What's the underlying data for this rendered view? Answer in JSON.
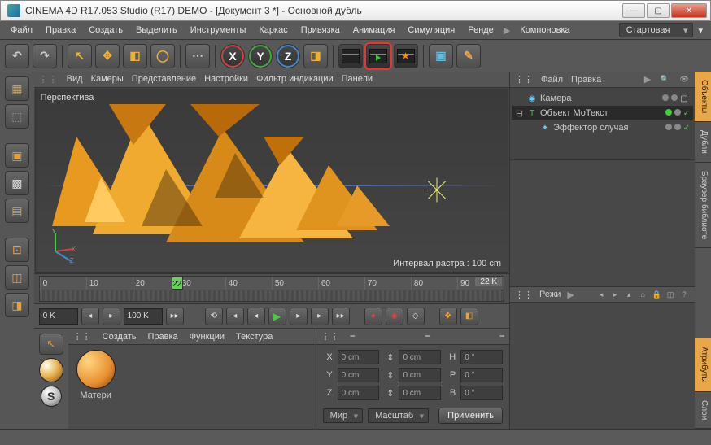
{
  "titlebar": {
    "text": "CINEMA 4D R17.053 Studio (R17) DEMO - [Документ 3 *] - Основной дубль"
  },
  "menubar": {
    "items": [
      "Файл",
      "Правка",
      "Создать",
      "Выделить",
      "Инструменты",
      "Каркас",
      "Привязка",
      "Анимация",
      "Симуляция",
      "Ренде"
    ],
    "items2": [
      "Компоновка"
    ],
    "layout": "Стартовая"
  },
  "viewport": {
    "menus": [
      "Вид",
      "Камеры",
      "Представление",
      "Настройки",
      "Фильтр индикации",
      "Панели"
    ],
    "label": "Перспектива",
    "info": "Интервал растра : 100 cm"
  },
  "timeline": {
    "ticks": [
      "0",
      "10",
      "20",
      "30",
      "40",
      "50",
      "60",
      "70",
      "80",
      "90"
    ],
    "marker": "22",
    "kf": "22 K",
    "start": "0 K",
    "end": "100 K"
  },
  "materials": {
    "menus": [
      "Создать",
      "Правка",
      "Функции",
      "Текстура"
    ],
    "slot0": "Матери"
  },
  "coords": {
    "labels": {
      "x": "X",
      "y": "Y",
      "z": "Z",
      "s1": "⇕",
      "s2": "⇕",
      "s3": "⇕",
      "h": "H",
      "p": "P",
      "b": "B"
    },
    "vals": {
      "px": "0 cm",
      "py": "0 cm",
      "pz": "0 cm",
      "sx": "0 cm",
      "sy": "0 cm",
      "sz": "0 cm",
      "rh": "0 °",
      "rp": "0 °",
      "rb": "0 °"
    },
    "dd1": "Мир",
    "dd2": "Масштаб",
    "apply": "Применить"
  },
  "objmgr": {
    "menus": [
      "Файл",
      "Правка"
    ],
    "rows": [
      "Камера",
      "Объект МоТекст",
      "Эффектор случая"
    ]
  },
  "attrs": {
    "label": "Режи"
  },
  "tabs": [
    "Объекты",
    "Дубли",
    "Браузер библиоте",
    "Атрибуты",
    "Слои"
  ]
}
